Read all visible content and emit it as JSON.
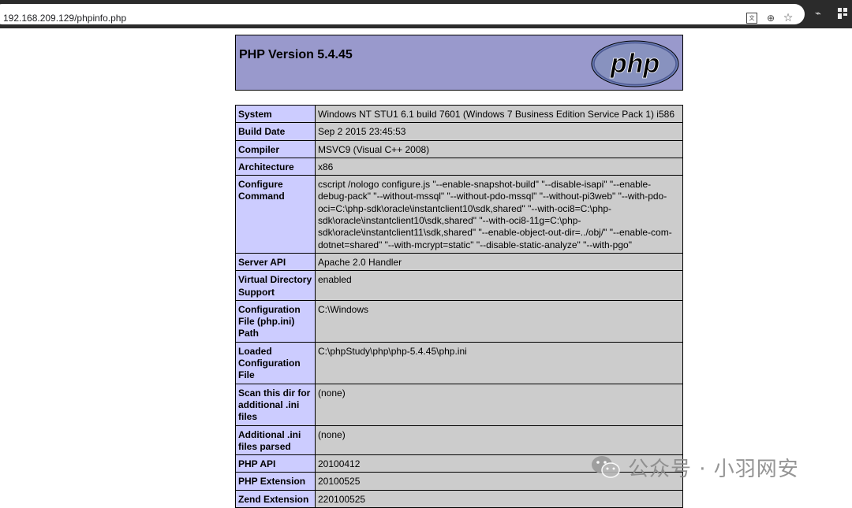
{
  "browser": {
    "url_lead": "≡",
    "url": "192.168.209.129/phpinfo.php",
    "icons": [
      "translate-icon",
      "zoom-icon",
      "bookmark-star-icon",
      "extension-icon",
      "menu-icon"
    ],
    "star_glyph": "☆",
    "zoom_glyph": "⊕",
    "translate_glyph": "文",
    "ext_glyph": "⌁"
  },
  "header": {
    "title": "PHP Version 5.4.45",
    "logo_text": "php",
    "bg_color": "#9999cc"
  },
  "info_rows": [
    {
      "key": "System",
      "value": "Windows NT STU1 6.1 build 7601 (Windows 7 Business Edition Service Pack 1) i586"
    },
    {
      "key": "Build Date",
      "value": "Sep 2 2015 23:45:53"
    },
    {
      "key": "Compiler",
      "value": "MSVC9 (Visual C++ 2008)"
    },
    {
      "key": "Architecture",
      "value": "x86"
    },
    {
      "key": "Configure Command",
      "value": "cscript /nologo configure.js \"--enable-snapshot-build\" \"--disable-isapi\" \"--enable-debug-pack\" \"--without-mssql\" \"--without-pdo-mssql\" \"--without-pi3web\" \"--with-pdo-oci=C:\\php-sdk\\oracle\\instantclient10\\sdk,shared\" \"--with-oci8=C:\\php-sdk\\oracle\\instantclient10\\sdk,shared\" \"--with-oci8-11g=C:\\php-sdk\\oracle\\instantclient11\\sdk,shared\" \"--enable-object-out-dir=../obj/\" \"--enable-com-dotnet=shared\" \"--with-mcrypt=static\" \"--disable-static-analyze\" \"--with-pgo\""
    },
    {
      "key": "Server API",
      "value": "Apache 2.0 Handler"
    },
    {
      "key": "Virtual Directory Support",
      "value": "enabled"
    },
    {
      "key": "Configuration File (php.ini) Path",
      "value": "C:\\Windows"
    },
    {
      "key": "Loaded Configuration File",
      "value": "C:\\phpStudy\\php\\php-5.4.45\\php.ini"
    },
    {
      "key": "Scan this dir for additional .ini files",
      "value": "(none)"
    },
    {
      "key": "Additional .ini files parsed",
      "value": "(none)"
    },
    {
      "key": "PHP API",
      "value": "20100412"
    },
    {
      "key": "PHP Extension",
      "value": "20100525"
    },
    {
      "key": "Zend Extension",
      "value": "220100525"
    }
  ],
  "watermark": {
    "text": "公众号 · 小羽网安"
  },
  "colors": {
    "key_bg": "#ccccff",
    "value_bg": "#cccccc",
    "chrome_bg": "#2b2b2b"
  }
}
